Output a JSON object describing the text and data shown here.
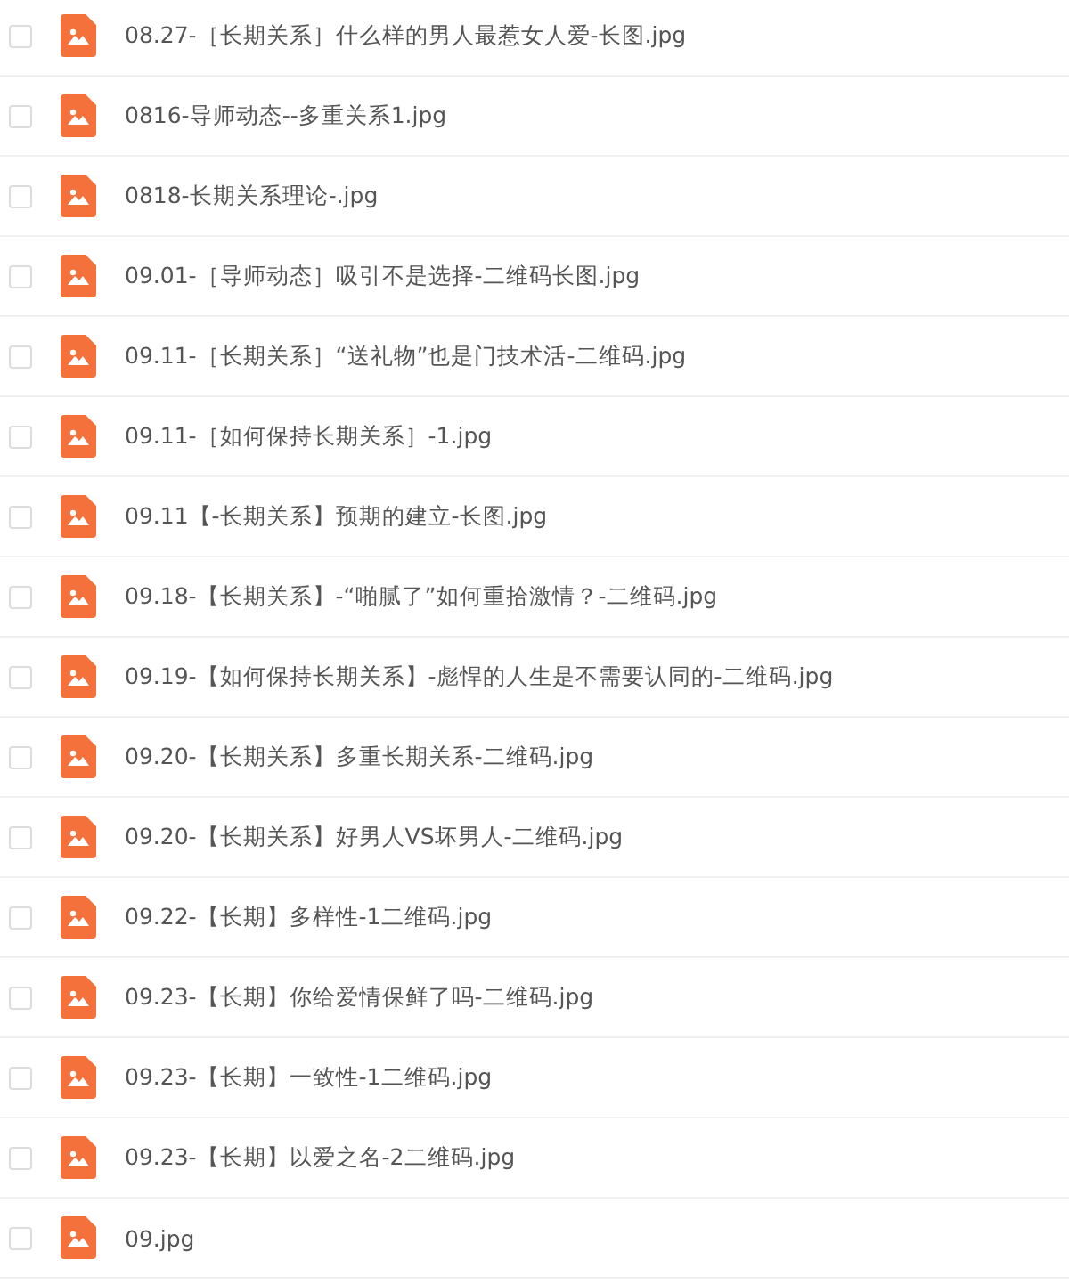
{
  "files": [
    {
      "name": "08.27-［长期关系］什么样的男人最惹女人爱-长图.jpg",
      "kind": "image",
      "checked": false
    },
    {
      "name": "0816-导师动态--多重关系1.jpg",
      "kind": "image",
      "checked": false
    },
    {
      "name": "0818-长期关系理论-.jpg",
      "kind": "image",
      "checked": false
    },
    {
      "name": "09.01-［导师动态］吸引不是选择-二维码长图.jpg",
      "kind": "image",
      "checked": false
    },
    {
      "name": "09.11-［长期关系］“送礼物”也是门技术活-二维码.jpg",
      "kind": "image",
      "checked": false
    },
    {
      "name": "09.11-［如何保持长期关系］-1.jpg",
      "kind": "image",
      "checked": false
    },
    {
      "name": "09.11【-长期关系】预期的建立-长图.jpg",
      "kind": "image",
      "checked": false
    },
    {
      "name": "09.18-【长期关系】-“啪腻了”如何重拾激情？-二维码.jpg",
      "kind": "image",
      "checked": false
    },
    {
      "name": "09.19-【如何保持长期关系】-彪悍的人生是不需要认同的-二维码.jpg",
      "kind": "image",
      "checked": false
    },
    {
      "name": "09.20-【长期关系】多重长期关系-二维码.jpg",
      "kind": "image",
      "checked": false
    },
    {
      "name": "09.20-【长期关系】好男人VS坏男人-二维码.jpg",
      "kind": "image",
      "checked": false
    },
    {
      "name": "09.22-【长期】多样性-1二维码.jpg",
      "kind": "image",
      "checked": false
    },
    {
      "name": "09.23-【长期】你给爱情保鲜了吗-二维码.jpg",
      "kind": "image",
      "checked": false
    },
    {
      "name": "09.23-【长期】一致性-1二维码.jpg",
      "kind": "image",
      "checked": false
    },
    {
      "name": "09.23-【长期】以爱之名-2二维码.jpg",
      "kind": "image",
      "checked": false
    },
    {
      "name": "09.jpg",
      "kind": "image",
      "checked": false
    }
  ]
}
